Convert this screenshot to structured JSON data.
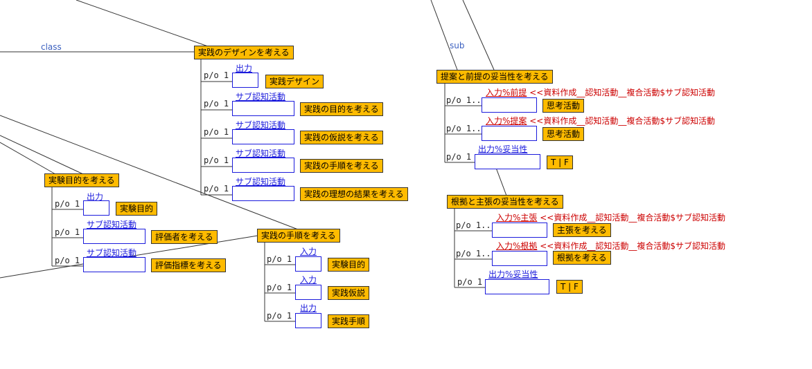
{
  "link_labels": {
    "class": "class",
    "sub": "sub"
  },
  "groups": {
    "practice_design": {
      "title": "実践のデザインを考える",
      "rows": [
        {
          "card": "p/o 1",
          "role": "出力",
          "value": "実践デザイン"
        },
        {
          "card": "p/o 1",
          "role": "サブ認知活動",
          "value": "実践の目的を考える"
        },
        {
          "card": "p/o 1",
          "role": "サブ認知活動",
          "value": "実践の仮説を考える"
        },
        {
          "card": "p/o 1",
          "role": "サブ認知活動",
          "value": "実践の手順を考える"
        },
        {
          "card": "p/o 1",
          "role": "サブ認知活動",
          "value": "実践の理想の結果を考える"
        }
      ]
    },
    "experiment_purpose": {
      "title": "実験目的を考える",
      "rows": [
        {
          "card": "p/o 1",
          "role": "出力",
          "value": "実験目的"
        },
        {
          "card": "p/o 1",
          "role": "サブ認知活動",
          "value": "評価者を考える"
        },
        {
          "card": "p/o 1",
          "role": "サブ認知活動",
          "value": "評価指標を考える"
        }
      ]
    },
    "practice_procedure": {
      "title": "実践の手順を考える",
      "rows": [
        {
          "card": "p/o 1",
          "role": "入力",
          "value": "実験目的"
        },
        {
          "card": "p/o 1",
          "role": "入力",
          "value": "実践仮説"
        },
        {
          "card": "p/o 1",
          "role": "出力",
          "value": "実践手順"
        }
      ]
    },
    "proposal_validity": {
      "title": "提案と前提の妥当性を考える",
      "rows": [
        {
          "card": "p/o 1..",
          "role": "入力%前提",
          "ref": "<<資料作成__認知活動__複合活動$サブ認知活動",
          "value": "思考活動"
        },
        {
          "card": "p/o 1..",
          "role": "入力%提案",
          "ref": "<<資料作成__認知活動__複合活動$サブ認知活動",
          "value": "思考活動"
        },
        {
          "card": "p/o 1",
          "role": "出力%妥当性",
          "value": "T | F"
        }
      ]
    },
    "evidence_validity": {
      "title": "根拠と主張の妥当性を考える",
      "rows": [
        {
          "card": "p/o 1..",
          "role": "入力%主張",
          "ref": "<<資料作成__認知活動__複合活動$サブ認知活動",
          "value": "主張を考える"
        },
        {
          "card": "p/o 1..",
          "role": "入力%根拠",
          "ref": "<<資料作成__認知活動__複合活動$サブ認知活動",
          "value": "根拠を考える"
        },
        {
          "card": "p/o 1",
          "role": "出力%妥当性",
          "value": "T | F"
        }
      ]
    }
  }
}
